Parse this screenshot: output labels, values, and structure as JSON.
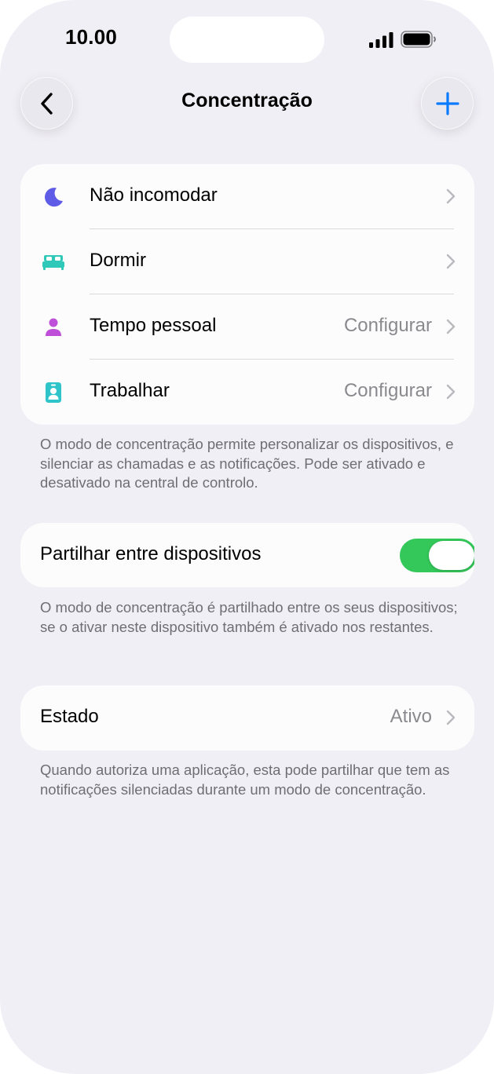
{
  "status_bar": {
    "time": "10.00",
    "icons": [
      "signal-icon",
      "battery-icon"
    ]
  },
  "nav": {
    "title": "Concentração",
    "back_icon": "chevron-left-icon",
    "add_icon": "plus-icon"
  },
  "focus_modes": [
    {
      "label": "Não incomodar",
      "value": "",
      "icon": "moon-icon",
      "icon_color": "#5e5ce6"
    },
    {
      "label": "Dormir",
      "value": "",
      "icon": "bed-icon",
      "icon_color": "#30c9b9"
    },
    {
      "label": "Tempo pessoal",
      "value": "Configurar",
      "icon": "person-icon",
      "icon_color": "#bf4fd8"
    },
    {
      "label": "Trabalhar",
      "value": "Configurar",
      "icon": "id-badge-icon",
      "icon_color": "#2ec4c9"
    }
  ],
  "modes_footnote": "O modo de concentração permite personalizar os dispositivos, e silenciar as chamadas e as notificações. Pode ser ativado e desativado na central de controlo.",
  "share": {
    "label": "Partilhar entre dispositivos",
    "enabled": true,
    "footnote": "O modo de concentração é partilhado entre os seus dispositivos; se o ativar neste dispositivo também é ativado nos restantes."
  },
  "state": {
    "label": "Estado",
    "value": "Ativo",
    "footnote": "Quando autoriza uma aplicação, esta pode partilhar que tem as notificações silenciadas durante um modo de concentração."
  },
  "colors": {
    "accent": "#0a7aff",
    "toggle_on": "#34c759",
    "background": "#f0eff5",
    "secondary_text": "#8a8a8e"
  }
}
